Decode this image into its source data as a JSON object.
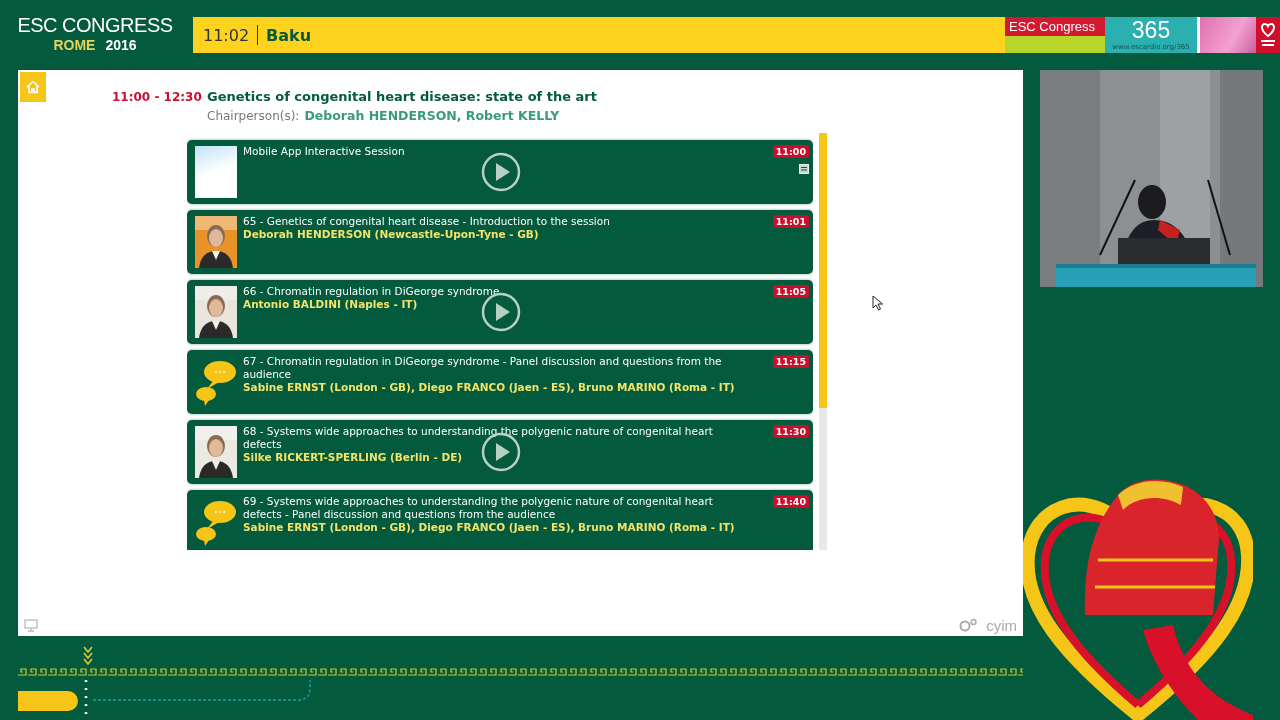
{
  "header": {
    "logo": {
      "title": "ESC CONGRESS",
      "city": "ROME",
      "year": "2016"
    },
    "time": "11:02",
    "room": "Baku",
    "banner": {
      "title": "ESC Congress",
      "number": "365",
      "url": "www.escardio.org/365"
    }
  },
  "session": {
    "time": "11:00 - 12:30",
    "title": "Genetics of congenital heart disease: state of the art",
    "chair_label": "Chairperson(s):",
    "chairs": "Deborah HENDERSON, Robert KELLY"
  },
  "talks": [
    {
      "kind": "blank",
      "title": "Mobile App Interactive Session",
      "time": "11:00",
      "video": true,
      "document": true
    },
    {
      "kind": "speaker",
      "title": "65 - Genetics of congenital heart disease - Introduction to the session",
      "speakers": "Deborah HENDERSON (Newcastle-Upon-Tyne - GB)",
      "time": "11:01",
      "video": false,
      "document": false
    },
    {
      "kind": "speaker",
      "title": "66 - Chromatin regulation in DiGeorge syndrome",
      "speakers": "Antonio BALDINI (Naples - IT)",
      "time": "11:05",
      "video": true,
      "document": false
    },
    {
      "kind": "discussion",
      "title": "67 - Chromatin regulation in DiGeorge syndrome - Panel discussion and questions from the audience",
      "speakers": "Sabine ERNST (London - GB), Diego FRANCO (Jaen - ES), Bruno MARINO (Roma - IT)",
      "time": "11:15",
      "video": false,
      "document": false
    },
    {
      "kind": "speaker",
      "title": "68 - Systems wide approaches to understanding the polygenic nature of congenital heart defects",
      "speakers": "Silke RICKERT-SPERLING (Berlin - DE)",
      "time": "11:30",
      "video": true,
      "document": false
    },
    {
      "kind": "discussion",
      "title": "69 - Systems wide approaches to understanding the polygenic nature of congenital heart defects - Panel discussion and questions from the audience",
      "speakers": "Sabine ERNST (London - GB), Diego FRANCO (Jaen - ES), Bruno MARINO (Roma - IT)",
      "time": "11:40",
      "video": false,
      "document": false
    }
  ],
  "footer": {
    "brand": "cyim"
  }
}
